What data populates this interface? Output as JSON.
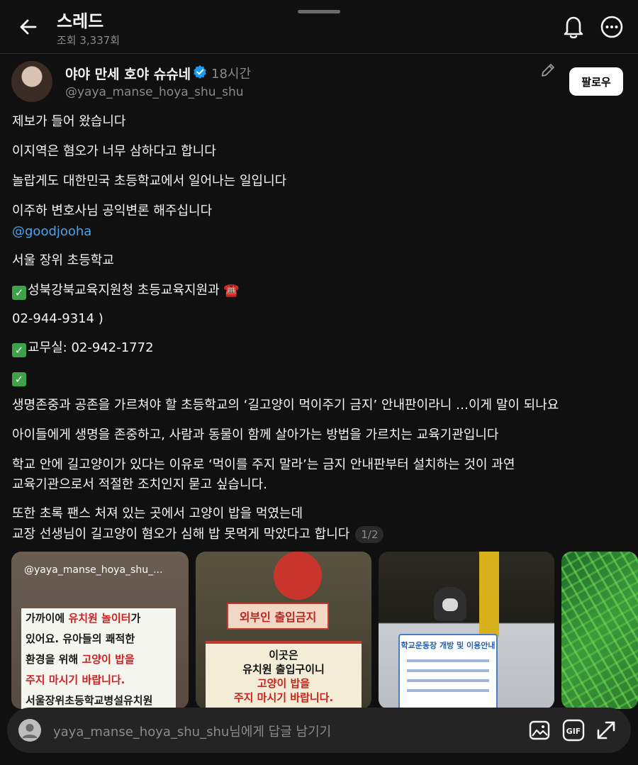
{
  "header": {
    "title": "스레드",
    "views": "조회 3,337회"
  },
  "post": {
    "username": "야야 만세 호야 슈슈네",
    "time": "18시간",
    "handle": "@yaya_manse_hoya_shu_shu",
    "follow_label": "팔로우",
    "lines": {
      "l1": "제보가 들어 왔습니다",
      "l2": "이지역은 혐오가 너무 삼하다고 합니다",
      "l3": "놀랍게도 대한민국 초등학교에서 일어나는 일입니다",
      "l4": "이주하 변호사님 공익변론 해주십니다",
      "mention": "@goodjooha",
      "l5": "서울 장위 초등학교",
      "l6": "성북강북교육지원청 초등교육지원과",
      "l6_emoji": "☎️",
      "l7": "02-944-9314 )",
      "l8": "교무실: 02-942-1772",
      "l9": "생명존중과 공존을 가르쳐야 할 초등학교의 ‘길고양이 먹이주기 금지’ 안내판이라니 …이게 말이 되나요",
      "l10": "아이들에게 생명을 존중하고, 사람과 동물이 함께 살아가는 방법을 가르치는 교육기관입니다",
      "l11a": "학교 안에 길고양이가 있다는 이유로 ‘먹이를 주지 말라’는 금지 안내판부터 설치하는 것이 과연",
      "l11b": "교육기관으로서 적절한 조치인지 묻고 싶습니다.",
      "l12a": "또한 초록 팬스 처져 있는 곳에서 고양이 밥을 먹였는데",
      "l12b": "교장 선생님이 길고양이 혐오가 심해 밥 못먹게 막았다고 합니다"
    },
    "page_indicator": "1/2"
  },
  "photos": {
    "p1": {
      "watermark": "@yaya_manse_hoya_shu_...",
      "sign_line1a": "가까이에 ",
      "sign_line1b": "유치원 놀이터",
      "sign_line1c": "가",
      "sign_line2": "있어요. 유아들의 쾌적한",
      "sign_line3a": "환경을 위해 ",
      "sign_line3b": "고양이 밥을",
      "sign_line4": "주지 마시기 바랍니다.",
      "sign_line5": "서울장위초등학교병설유치원"
    },
    "p2": {
      "banner": "외부인 출입금지",
      "house_line1": "이곳은",
      "house_line2": "유치원 출입구이니",
      "house_line3": "고양이 밥을",
      "house_line4": "주지 마시기 바랍니다."
    },
    "p3": {
      "notice_title": "학교운동장 개방 및 이용안내"
    }
  },
  "reply": {
    "placeholder": "yaya_manse_hoya_shu_shu님에게 답글 남기기",
    "gif_label": "GIF"
  },
  "colors": {
    "background": "#101010",
    "mention": "#4aa3f0",
    "verified": "#1d9bf0",
    "check": "#3ea24a"
  },
  "icons": [
    "back-arrow-icon",
    "bell-icon",
    "more-icon",
    "verified-badge-icon",
    "pencil-icon",
    "check-icon",
    "telephone-icon",
    "user-icon",
    "image-icon",
    "gif-icon",
    "expand-icon"
  ]
}
